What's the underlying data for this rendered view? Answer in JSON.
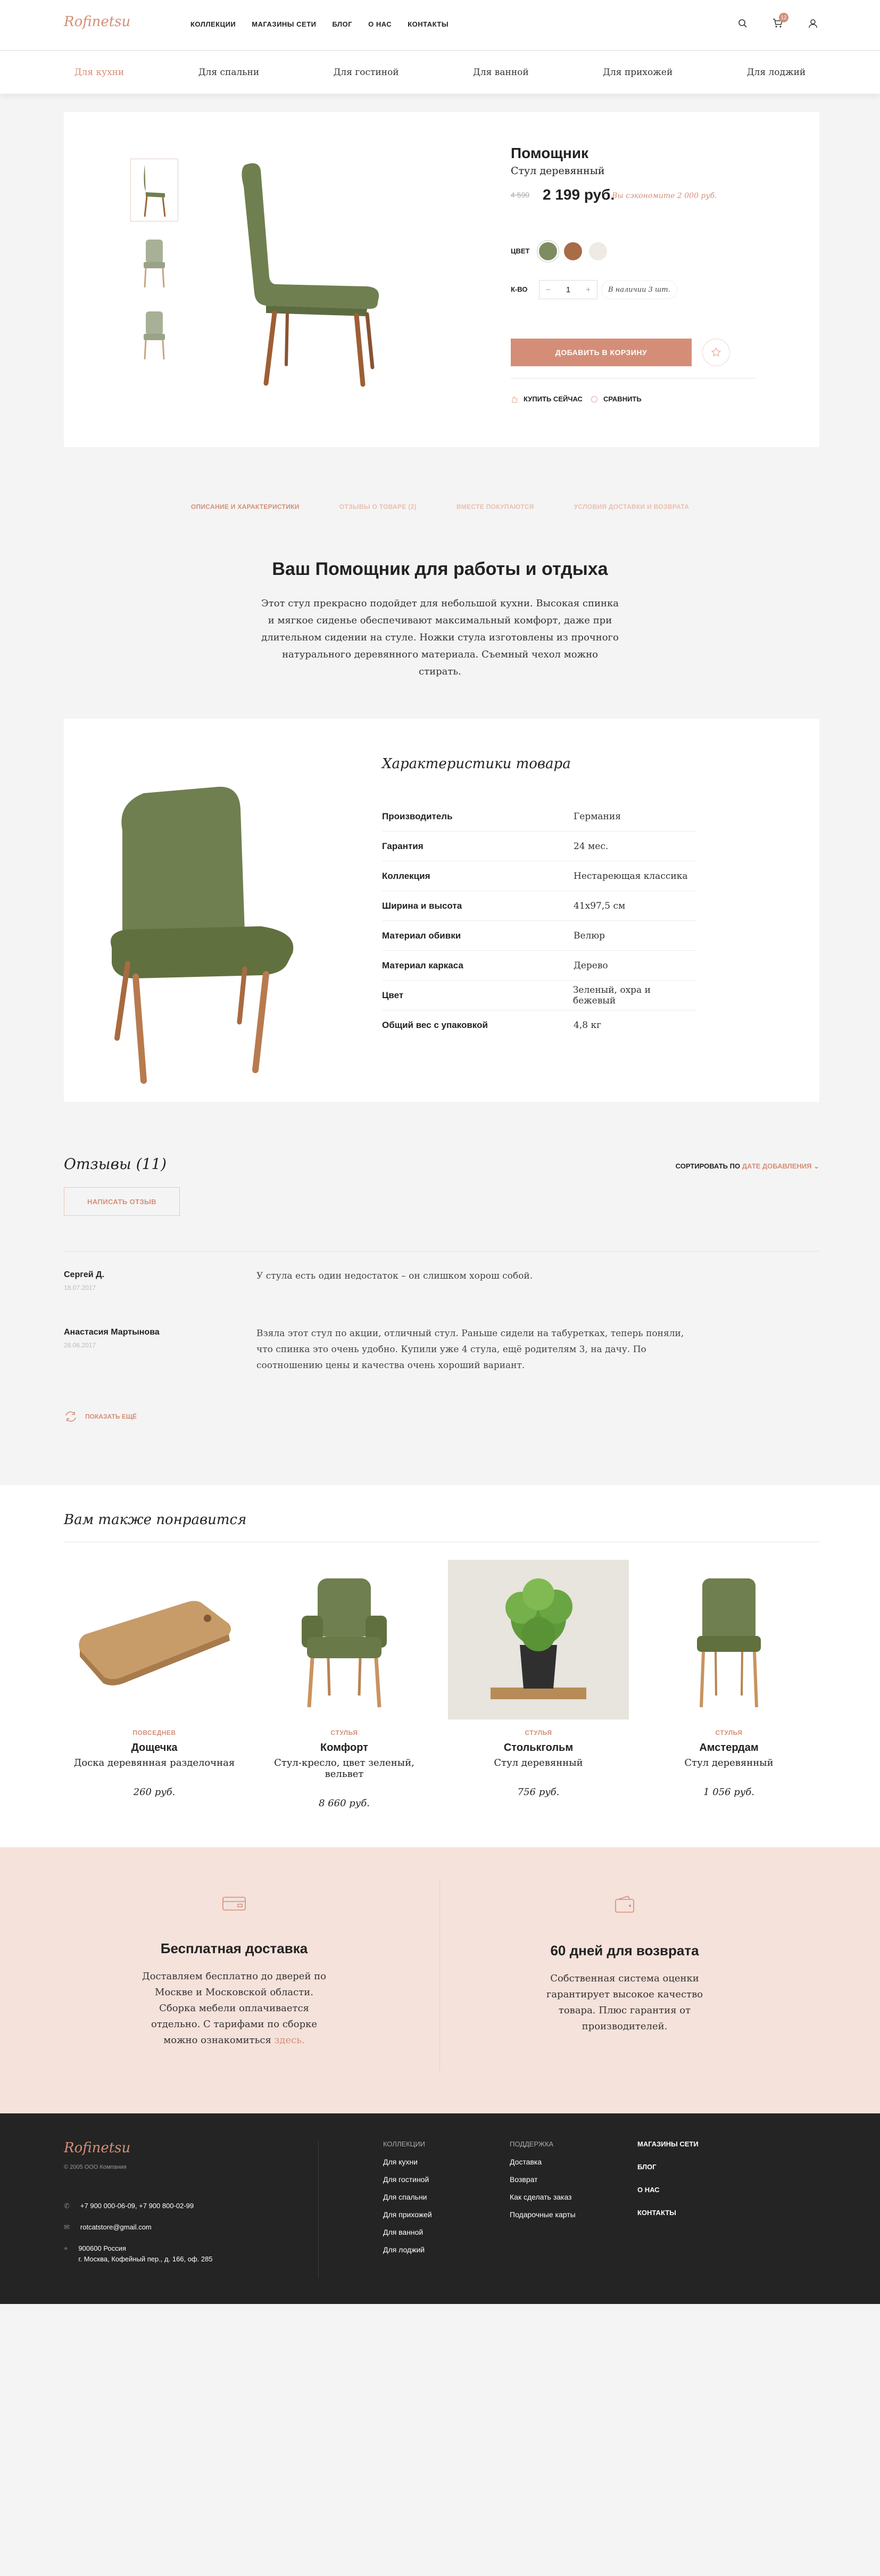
{
  "header": {
    "logo": "Rofinetsu",
    "nav": [
      "КОЛЛЕКЦИИ",
      "МАГАЗИНЫ СЕТИ",
      "БЛОГ",
      "О НАС",
      "КОНТАКТЫ"
    ],
    "cart_count": "12"
  },
  "categories": [
    "Для кухни",
    "Для спальни",
    "Для гостиной",
    "Для ванной",
    "Для прихожей",
    "Для лоджий"
  ],
  "product": {
    "name": "Помощник",
    "subtitle": "Стул деревянный",
    "old_price": "4 590",
    "price": "2 199 руб.",
    "save_note": "Вы сэкономите 2 000 руб.",
    "color_label": "ЦВЕТ",
    "colors": [
      "#7e8c61",
      "#a86c47",
      "#eeeae4"
    ],
    "qty_label": "К-ВО",
    "qty": "1",
    "qty_minus": "−",
    "qty_plus": "+",
    "stock": "В наличии 3 шт.",
    "cart_button": "ДОБАВИТЬ В КОРЗИНУ",
    "buy_now": "КУПИТЬ СЕЙЧАС",
    "compare": "СРАВНИТЬ"
  },
  "tabs": [
    "ОПИСАНИЕ И ХАРАКТЕРИСТИКИ",
    "ОТЗЫВЫ О ТОВАРЕ (2)",
    "ВМЕСТЕ ПОКУПАЮТСЯ",
    "УСЛОВИЯ ДОСТАВКИ И ВОЗВРАТА"
  ],
  "description": {
    "title": "Ваш Помощник для работы и отдыха",
    "text": "Этот стул прекрасно подойдет для небольшой кухни. Высокая спинка и мягкое сиденье обеспечивают максимальный комфорт, даже при длительном сидении на стуле. Ножки стула изготовлены из прочного натурального деревянного материала. Съемный чехол можно стирать."
  },
  "specs": {
    "title": "Характеристики товара",
    "rows": [
      {
        "k": "Производитель",
        "v": "Германия"
      },
      {
        "k": "Гарантия",
        "v": "24 мес."
      },
      {
        "k": "Коллекция",
        "v": "Нестареющая классика"
      },
      {
        "k": "Ширина и высота",
        "v": "41х97,5 см"
      },
      {
        "k": "Материал обивки",
        "v": "Велюр"
      },
      {
        "k": "Материал каркаса",
        "v": "Дерево"
      },
      {
        "k": "Цвет",
        "v": "Зеленый, охра и бежевый"
      },
      {
        "k": "Общий вес с упаковкой",
        "v": "4,8 кг"
      }
    ]
  },
  "reviews": {
    "title": "Отзывы (11)",
    "sort_label": "СОРТИРОВАТЬ ПО",
    "sort_value": "ДАТЕ ДОБАВЛЕНИЯ",
    "write_button": "НАПИСАТЬ ОТЗЫВ",
    "items": [
      {
        "name": "Сергей Д.",
        "date": "18.07.2017",
        "text": "У стула есть один недостаток – он слишком хорош собой."
      },
      {
        "name": "Анастасия Мартынова",
        "date": "28.06.2017",
        "text": "Взяла этот стул по акции, отличный стул. Раньше сидели на табуретках, теперь поняли, что спинка это очень удобно. Купили уже 4 стула, ещё родителям 3, на дачу. По соотношению цены и качества очень хороший вариант."
      }
    ],
    "more": "ПОКАЗАТЬ ЕЩЁ"
  },
  "recommended": {
    "title": "Вам также понравится",
    "items": [
      {
        "cat": "ПОВСЕДНЕВ",
        "name": "Дощечка",
        "desc": "Доска деревянная разделочная",
        "price": "260 руб."
      },
      {
        "cat": "СТУЛЬЯ",
        "name": "Комфорт",
        "desc": "Стул-кресло, цвет зеленый, вельвет",
        "price": "8 660 руб."
      },
      {
        "cat": "СТУЛЬЯ",
        "name": "Столькгольм",
        "desc": "Стул деревянный",
        "price": "756 руб."
      },
      {
        "cat": "СТУЛЬЯ",
        "name": "Амстердам",
        "desc": "Стул деревянный",
        "price": "1 056 руб."
      }
    ]
  },
  "benefits": [
    {
      "title": "Бесплатная доставка",
      "text": "Доставляем бесплатно до дверей по Москве и Московской области. Сборка мебели оплачивается отдельно. С тарифами по сборке можно ознакомиться",
      "link": "здесь."
    },
    {
      "title": "60 дней для возврата",
      "text": "Собственная система оценки гарантирует высокое качество товара. Плюс гарантия от производителей.",
      "link": ""
    }
  ],
  "footer": {
    "logo": "Rofinetsu",
    "copyright": "© 2005 ООО Компания",
    "phone": "+7 900 000-06-09, +7 900 800-02-99",
    "email": "rotcatstore@gmail.com",
    "address1": "900600 Россия",
    "address2": "г. Москва, Кофейный пер., д. 166, оф. 285",
    "col1_head": "КОЛЛЕКЦИИ",
    "col1": [
      "Для кухни",
      "Для гостиной",
      "Для спальни",
      "Для прихожей",
      "Для ванной",
      "Для лоджий"
    ],
    "col2_head": "ПОДДЕРЖКА",
    "col2": [
      "Доставка",
      "Возврат",
      "Как сделать заказ",
      "Подарочные карты"
    ],
    "col3": [
      "МАГАЗИНЫ СЕТИ",
      "БЛОГ",
      "О НАС",
      "КОНТАКТЫ"
    ]
  }
}
